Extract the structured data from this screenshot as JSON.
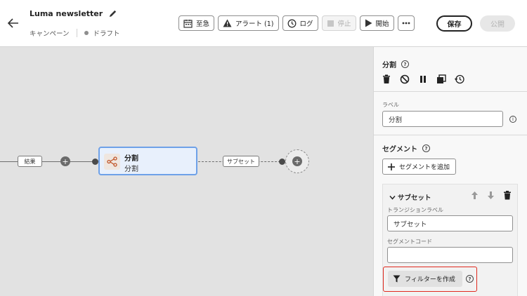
{
  "header": {
    "title": "Luma newsletter",
    "breadcrumb": "キャンペーン",
    "status": "ドラフト",
    "toolbar": {
      "urgent": "至急",
      "alerts": "アラート (1)",
      "logs": "ログ",
      "stop": "停止",
      "start": "開始"
    },
    "save": "保存",
    "publish": "公開"
  },
  "canvas": {
    "left_edge_label": "結果",
    "node": {
      "title": "分割",
      "subtitle": "分割"
    },
    "right_edge_label": "サブセット"
  },
  "panel": {
    "title": "分割",
    "label_field": {
      "label": "ラベル",
      "value": "分割"
    },
    "segments_title": "セグメント",
    "add_segment": "セグメントを追加",
    "segment": {
      "name": "サブセット",
      "transition_label": "トランジションラベル",
      "transition_value": "サブセット",
      "code_label": "セグメントコード",
      "code_value": "",
      "create_filter": "フィルターを作成"
    }
  },
  "colors": {
    "node_border": "#6ea1e8",
    "node_fill": "#e8f0fc",
    "highlight": "#e02a1f"
  }
}
